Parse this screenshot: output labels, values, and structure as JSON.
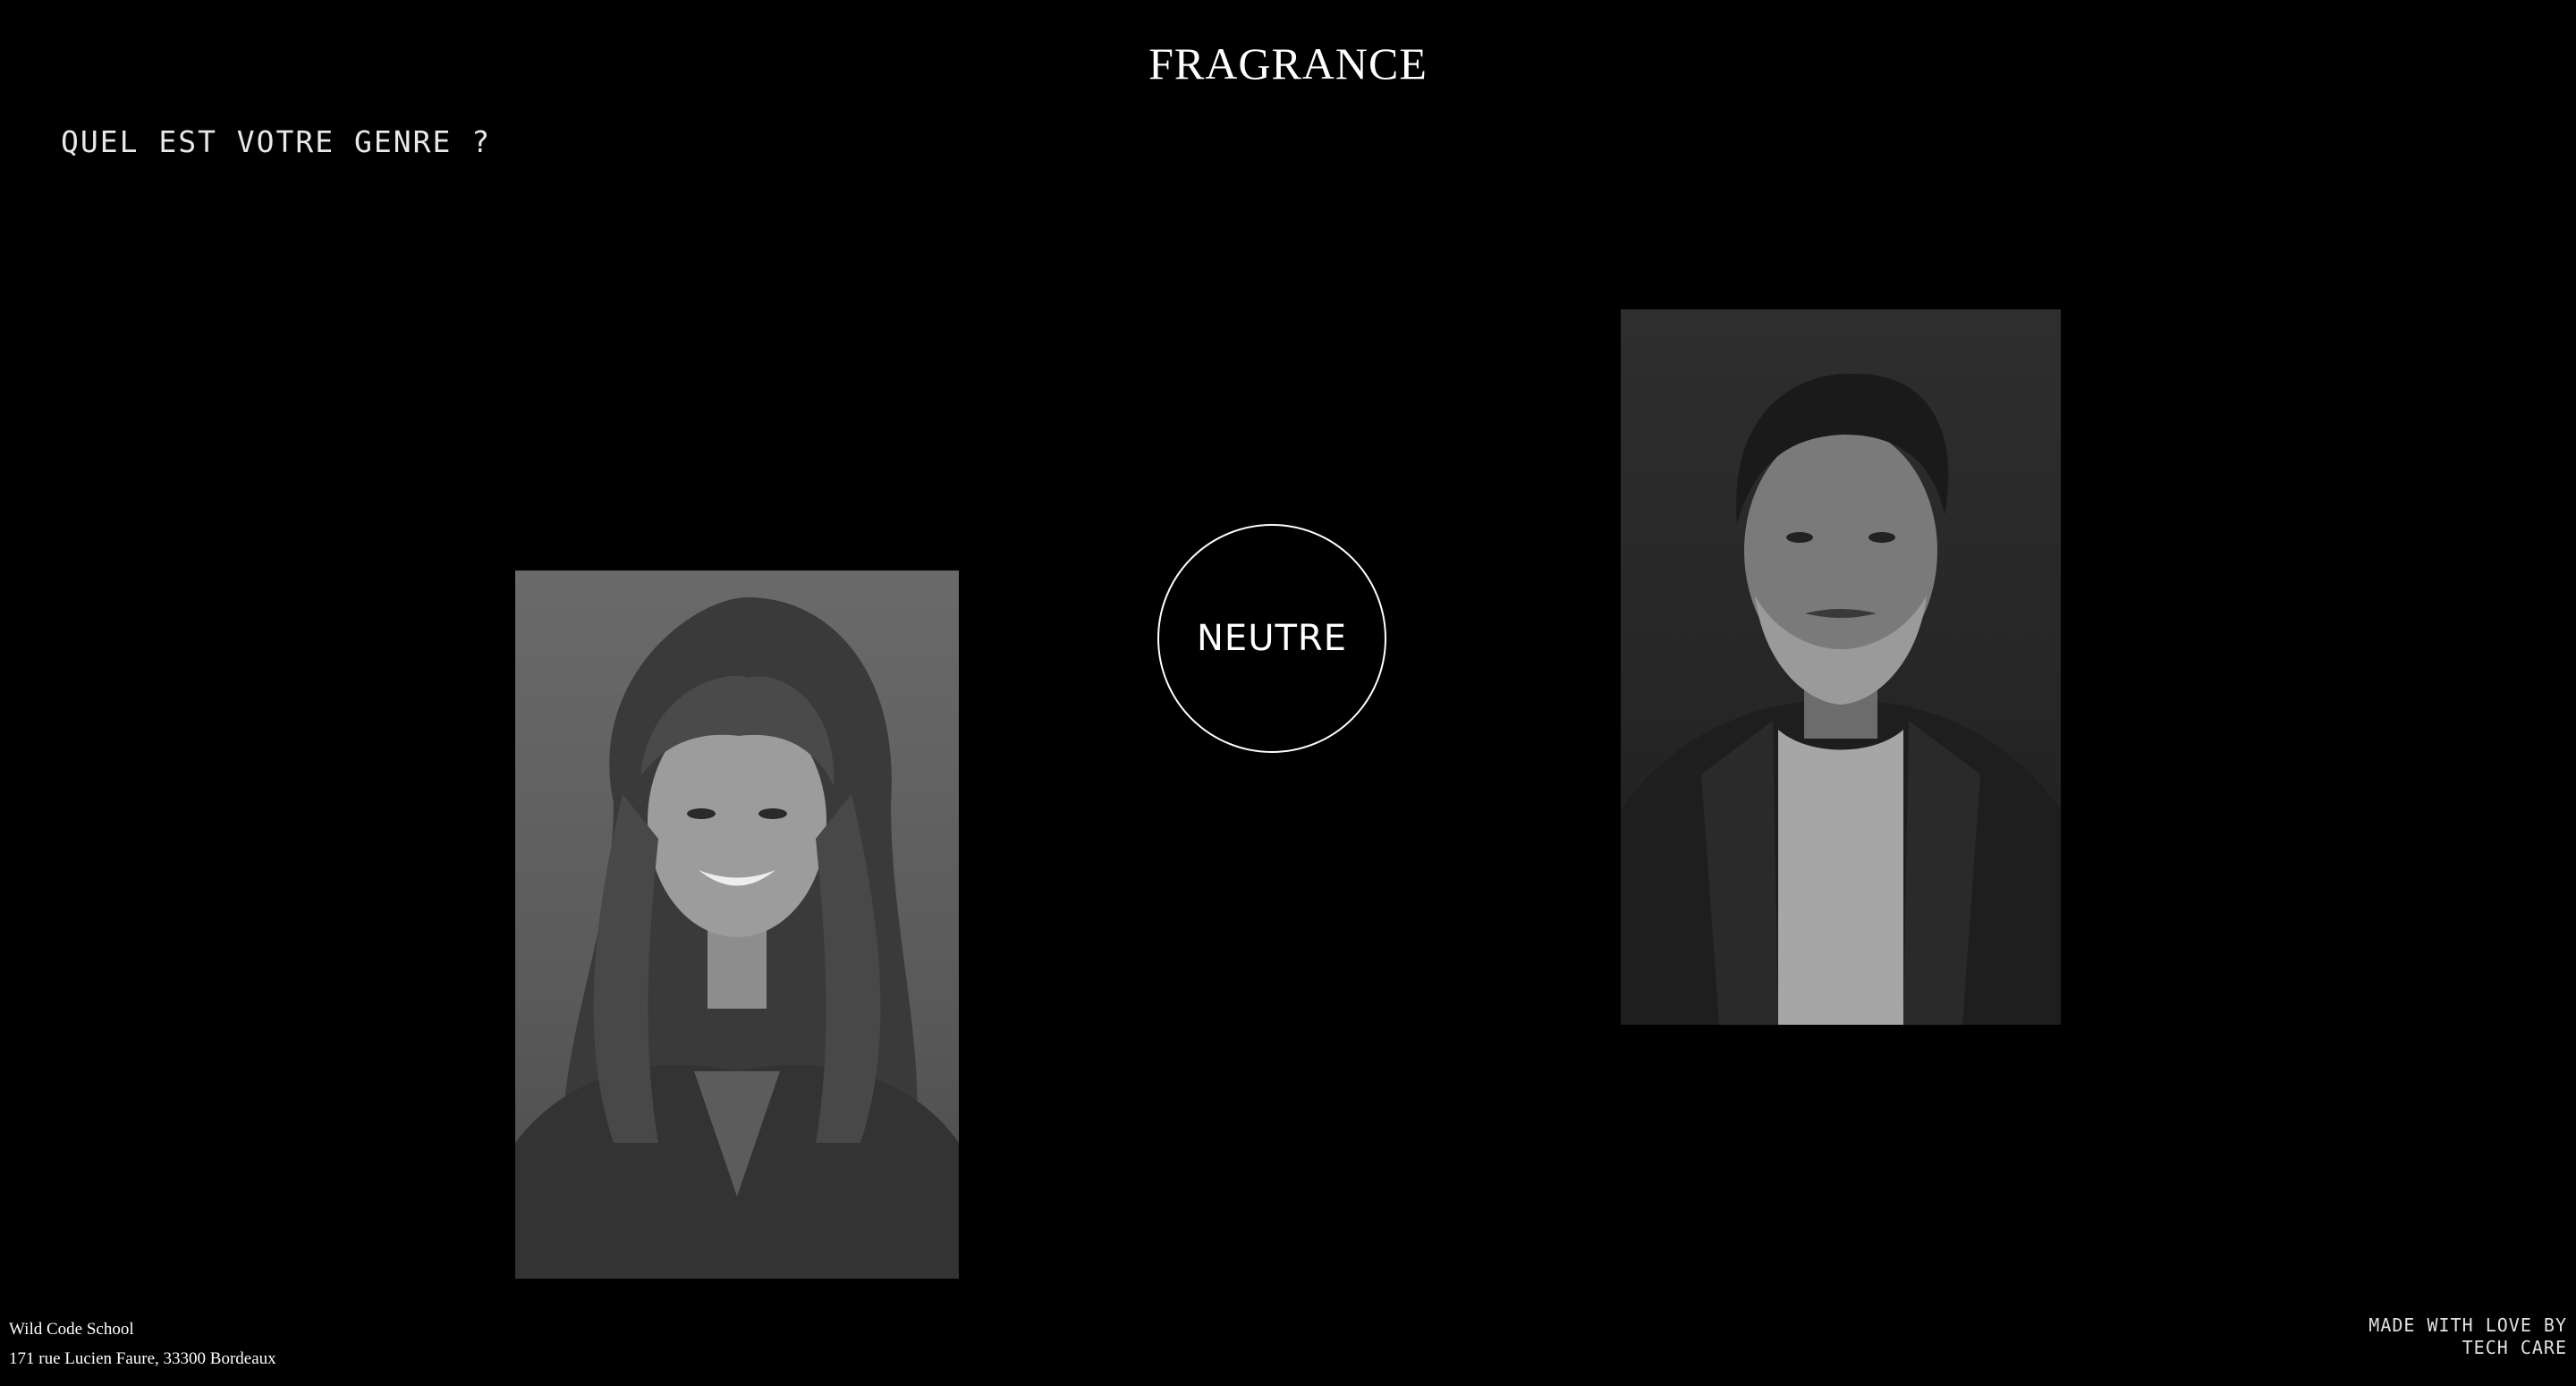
{
  "header": {
    "brand": "FRAGRANCE"
  },
  "quiz": {
    "question": "QUEL EST VOTRE GENRE ?",
    "neutral_label": "NEUTRE",
    "options": [
      "female-portrait",
      "neutral",
      "male-portrait"
    ]
  },
  "footer": {
    "school_name": "Wild Code School",
    "address": "171 rue Lucien Faure, 33300 Bordeaux",
    "credit_line1": "MADE WITH LOVE BY",
    "credit_line2": "TECH CARE"
  },
  "colors": {
    "background": "#000000",
    "text": "#ffffff"
  }
}
